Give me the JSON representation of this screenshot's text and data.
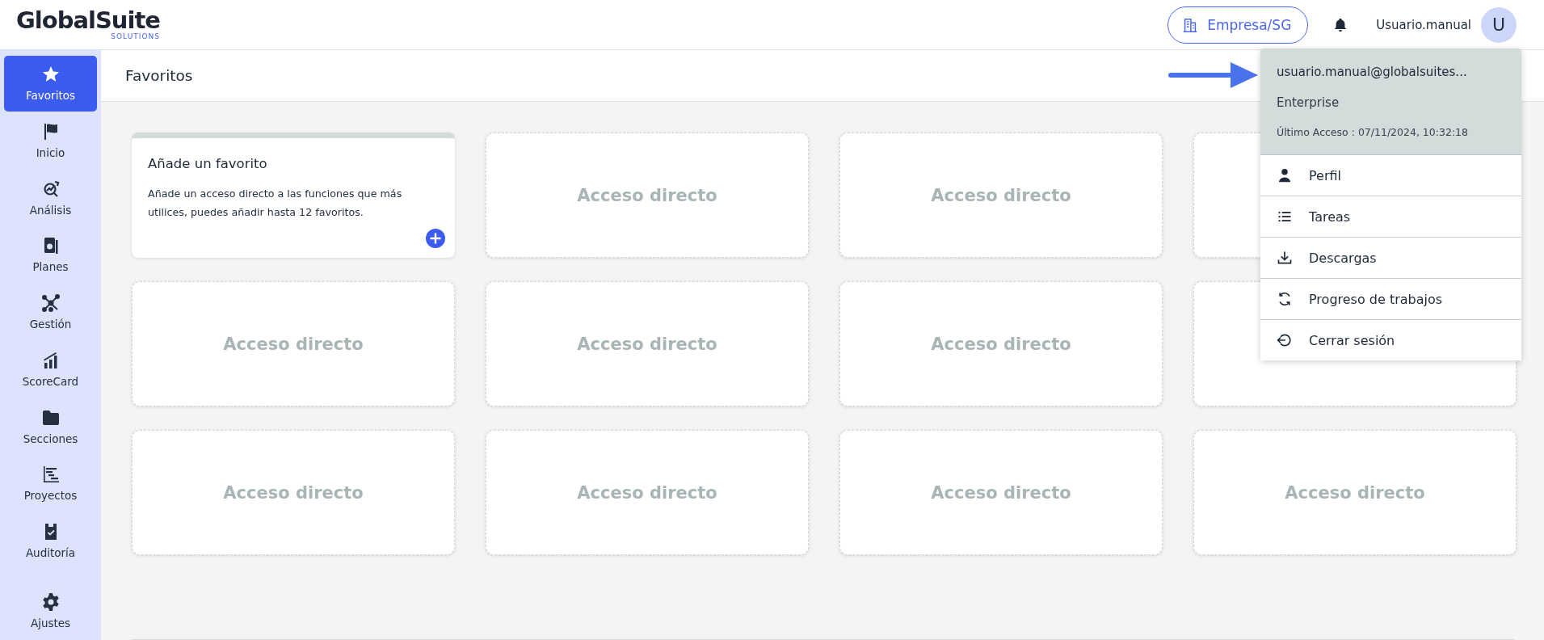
{
  "logo": {
    "name": "GlobalSuite",
    "tagline": "SOLUTIONS"
  },
  "header": {
    "company_button": "Empresa/SG",
    "username": "Usuario.manual",
    "avatar": "U"
  },
  "sidebar": {
    "items": [
      {
        "label": "Favoritos",
        "selected": true
      },
      {
        "label": "Inicio",
        "selected": false
      },
      {
        "label": "Análisis",
        "selected": false
      },
      {
        "label": "Planes",
        "selected": false
      },
      {
        "label": "Gestión",
        "selected": false
      },
      {
        "label": "ScoreCard",
        "selected": false
      },
      {
        "label": "Secciones",
        "selected": false
      },
      {
        "label": "Proyectos",
        "selected": false
      },
      {
        "label": "Auditoría",
        "selected": false
      }
    ],
    "settings": {
      "label": "Ajustes",
      "selected": false
    }
  },
  "page_title": "Favoritos",
  "cards": [
    {
      "kind": "add",
      "title": "Añade un favorito",
      "text": "Añade un acceso directo a las funciones que más utilices, puedes añadir hasta 12 favoritos."
    },
    {
      "kind": "shortcut",
      "label": "Acceso directo"
    },
    {
      "kind": "shortcut",
      "label": "Acceso directo"
    },
    {
      "kind": "shortcut"
    },
    {
      "kind": "shortcut",
      "label": "Acceso directo"
    },
    {
      "kind": "shortcut",
      "label": "Acceso directo"
    },
    {
      "kind": "shortcut",
      "label": "Acceso directo"
    },
    {
      "kind": "shortcut"
    },
    {
      "kind": "shortcut",
      "label": "Acceso directo"
    },
    {
      "kind": "shortcut",
      "label": "Acceso directo"
    },
    {
      "kind": "shortcut",
      "label": "Acceso directo"
    },
    {
      "kind": "shortcut",
      "label": "Acceso directo"
    }
  ],
  "user_menu": {
    "email": "usuario.manual@globalsuites...",
    "plan": "Enterprise",
    "last_access": "Último Acceso : 07/11/2024, 10:32:18",
    "items": [
      {
        "label": "Perfil"
      },
      {
        "label": "Tareas"
      },
      {
        "label": "Descargas"
      },
      {
        "label": "Progreso de trabajos"
      },
      {
        "label": "Cerrar sesión"
      }
    ]
  }
}
